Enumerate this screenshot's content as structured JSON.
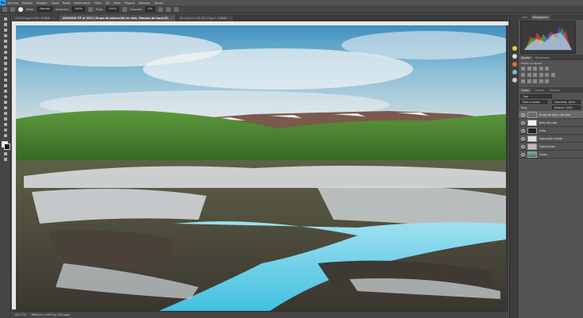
{
  "menubar": {
    "logo": "Ps",
    "items": [
      "Archivo",
      "Edición",
      "Imagen",
      "Capa",
      "Texto",
      "Seleccionar",
      "Filtro",
      "3D",
      "Vista",
      "Plugins",
      "Ventana",
      "Ayuda"
    ]
  },
  "options": {
    "mode_label": "Modo:",
    "mode_value": "Normal",
    "opacity_label": "Opacidad:",
    "opacity_value": "100%",
    "flow_label": "Flujo:",
    "flow_value": "100%",
    "smoothing_label": "Suavizar:",
    "smoothing_value": "0%"
  },
  "tabs": [
    {
      "label": "2023.04.jpg al 50% (RGB/8)",
      "active": false
    },
    {
      "label": "20230406.TIF al 141% (Grupo de saturación de cielo, Máscara de capa/16)",
      "active": true
    },
    {
      "label": "Sin título-1 al 61,9% (Capa 1, RGB/8)",
      "active": false
    }
  ],
  "status": {
    "zoom": "141,17%",
    "doc": "3888 px x 2592 px (300 ppp)"
  },
  "panels": {
    "top_tabs": [
      "Color",
      "Histograma"
    ],
    "mid_tabs": [
      "Ajustes",
      "Bibliotecas"
    ],
    "adjust_hint": "Añadir un ajuste",
    "layer_tabs": [
      "Capas",
      "Canales",
      "Trazados"
    ],
    "kind_label": "Tipo",
    "blend_mode": "Pase a través",
    "opacity": "Opacidad: 100%",
    "lock_label": "Bloq.:",
    "fill": "Relleno: 100%",
    "layers": [
      {
        "name": "Grupo de satur...de cielo",
        "selected": true
      },
      {
        "name": "Brillo del cielo",
        "selected": false
      },
      {
        "name": "Cielo",
        "selected": false
      },
      {
        "name": "Saturación frontal",
        "selected": false
      },
      {
        "name": "Color frontal",
        "selected": false
      },
      {
        "name": "Fondo",
        "selected": false
      }
    ]
  }
}
